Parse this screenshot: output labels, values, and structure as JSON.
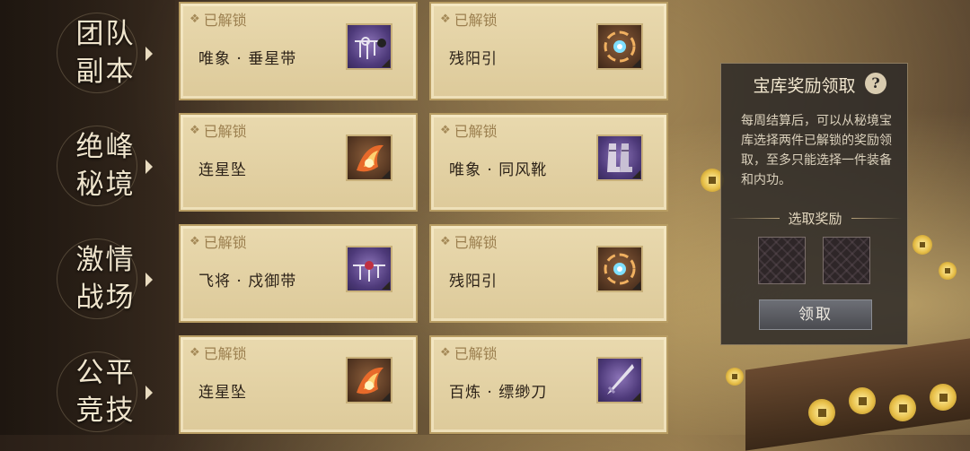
{
  "nav": [
    {
      "label": "团队副本"
    },
    {
      "label": "绝峰秘境"
    },
    {
      "label": "激情战场"
    },
    {
      "label": "公平竞技"
    }
  ],
  "cards": [
    {
      "status": "已解锁",
      "name": "唯象 · 垂星带",
      "icon": "belt-icon",
      "rarity": "purple"
    },
    {
      "status": "已解锁",
      "name": "残阳引",
      "icon": "fire-orb-icon",
      "rarity": "brown"
    },
    {
      "status": "已解锁",
      "name": "连星坠",
      "icon": "flame-pendant-icon",
      "rarity": "brown"
    },
    {
      "status": "已解锁",
      "name": "唯象 · 同风靴",
      "icon": "boots-icon",
      "rarity": "purple"
    },
    {
      "status": "已解锁",
      "name": "飞将 · 戍御带",
      "icon": "belt-icon",
      "rarity": "purple"
    },
    {
      "status": "已解锁",
      "name": "残阳引",
      "icon": "fire-orb-icon",
      "rarity": "brown"
    },
    {
      "status": "已解锁",
      "name": "连星坠",
      "icon": "flame-pendant-icon",
      "rarity": "brown"
    },
    {
      "status": "已解锁",
      "name": "百炼 · 缥缈刀",
      "icon": "blade-icon",
      "rarity": "purple"
    }
  ],
  "panel": {
    "title": "宝库奖励领取",
    "help": "?",
    "description": "每周结算后，可以从秘境宝库选择两件已解锁的奖励领取，至多只能选择一件装备和内功。",
    "section_label": "选取奖励",
    "claim_label": "领取"
  }
}
